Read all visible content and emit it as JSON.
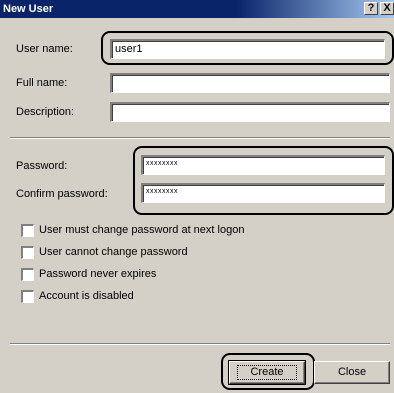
{
  "window": {
    "title": "New User",
    "help_glyph": "?",
    "close_glyph": "X"
  },
  "form": {
    "username": {
      "label": "User name:",
      "value": "user1"
    },
    "fullname": {
      "label": "Full name:",
      "value": ""
    },
    "description": {
      "label": "Description:",
      "value": ""
    },
    "password": {
      "label": "Password:",
      "value": "xxxxxxxx"
    },
    "confirm": {
      "label": "Confirm password:",
      "value": "xxxxxxxx"
    }
  },
  "options": [
    {
      "label": "User must change password at next logon",
      "checked": false
    },
    {
      "label": "User cannot change password",
      "checked": false
    },
    {
      "label": "Password never expires",
      "checked": false
    },
    {
      "label": "Account is disabled",
      "checked": false
    }
  ],
  "buttons": {
    "create": "Create",
    "close": "Close"
  },
  "colors": {
    "titlebar": "#0a246a",
    "face": "#d4d0c8",
    "highlight_ring": "#000000"
  }
}
